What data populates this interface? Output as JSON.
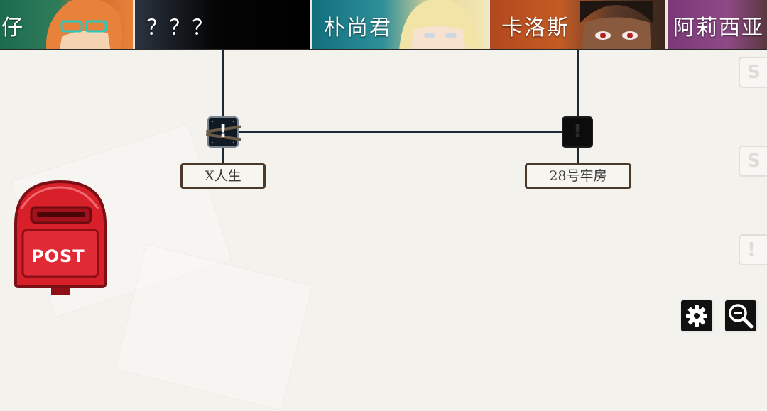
{
  "characters": [
    {
      "name": "仔",
      "theme": "#2f7d5a"
    },
    {
      "name": "？？？",
      "theme": "#050505"
    },
    {
      "name": "朴尚君",
      "theme": "#2e8f99"
    },
    {
      "name": "卡洛斯",
      "theme": "#c45b24"
    },
    {
      "name": "阿莉西亚",
      "theme": "#8e4a86"
    }
  ],
  "nodes": [
    {
      "label": "X人生",
      "state": "unlocked",
      "icon": "exclamation-icon"
    },
    {
      "label": "28号牢房",
      "state": "locked",
      "icon": "exclamation-icon"
    }
  ],
  "node_glyph": "!",
  "side_buttons": [
    "S",
    "S",
    "!"
  ],
  "mailbox": {
    "label": "POST",
    "color": "#d8202b"
  },
  "controls": {
    "settings_icon": "gear-icon",
    "zoom_icon": "zoom-out-icon"
  }
}
